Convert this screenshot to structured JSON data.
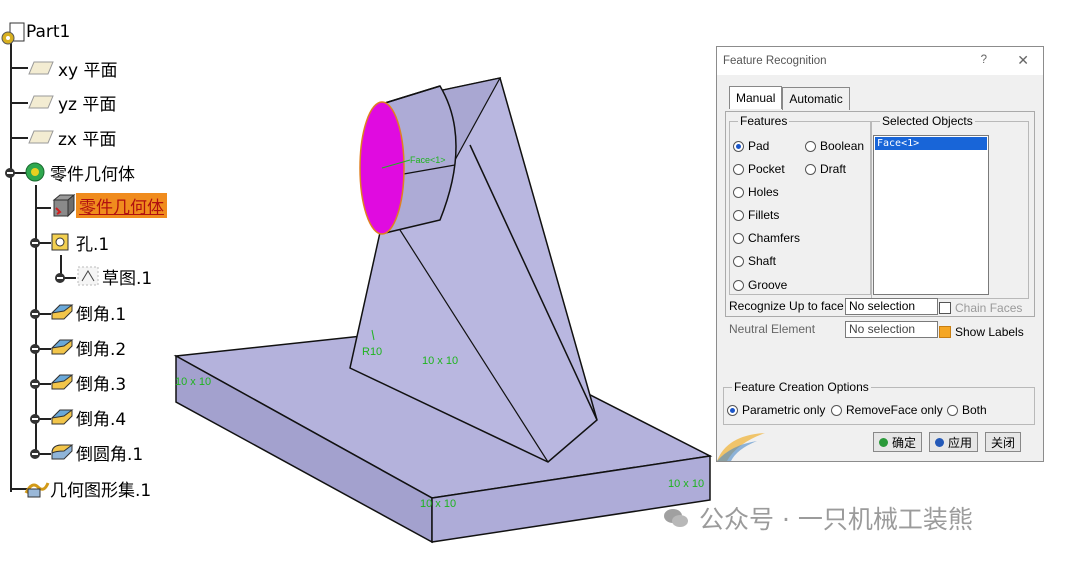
{
  "tree": {
    "root": "Part1",
    "planes": [
      "xy 平面",
      "yz 平面",
      "zx 平面"
    ],
    "body": "零件几何体",
    "selected": "零件几何体",
    "hole": "孔.1",
    "sketch": "草图.1",
    "chamfers": [
      "倒角.1",
      "倒角.2",
      "倒角.3",
      "倒角.4"
    ],
    "fillet": "倒圆角.1",
    "geoset": "几何图形集.1"
  },
  "model": {
    "labels": [
      "Face<1>",
      "R10",
      "10 x 10",
      "10 x 10",
      "10 x 10",
      "10 x 10",
      "10 x 10"
    ],
    "colors": {
      "body": "#b4b2dc",
      "face": "#e00be0",
      "edge": "#000000",
      "label": "#1eb41e"
    }
  },
  "dialog": {
    "title": "Feature Recognition",
    "help": "?",
    "close": "✕",
    "tabs": [
      "Manual",
      "Automatic"
    ],
    "features_title": "Features",
    "features": [
      "Pad",
      "Boolean",
      "Pocket",
      "Draft",
      "Holes",
      "Fillets",
      "Chamfers",
      "Shaft",
      "Groove"
    ],
    "selected_feature": "Pad",
    "selected_objects_title": "Selected Objects",
    "selected_objects": [
      "Face<1>"
    ],
    "recognize_label": "Recognize Up to face",
    "recognize_value": "No selection",
    "chain_faces": "Chain Faces",
    "neutral_label": "Neutral Element",
    "neutral_value": "No selection",
    "show_labels": "Show Labels",
    "creation_title": "Feature Creation Options",
    "options": [
      "Parametric only",
      "RemoveFace only",
      "Both"
    ],
    "selected_option": "Parametric only",
    "buttons": {
      "ok": "确定",
      "apply": "应用",
      "close": "关闭"
    }
  },
  "watermark": "公众号 · 一只机械工装熊"
}
